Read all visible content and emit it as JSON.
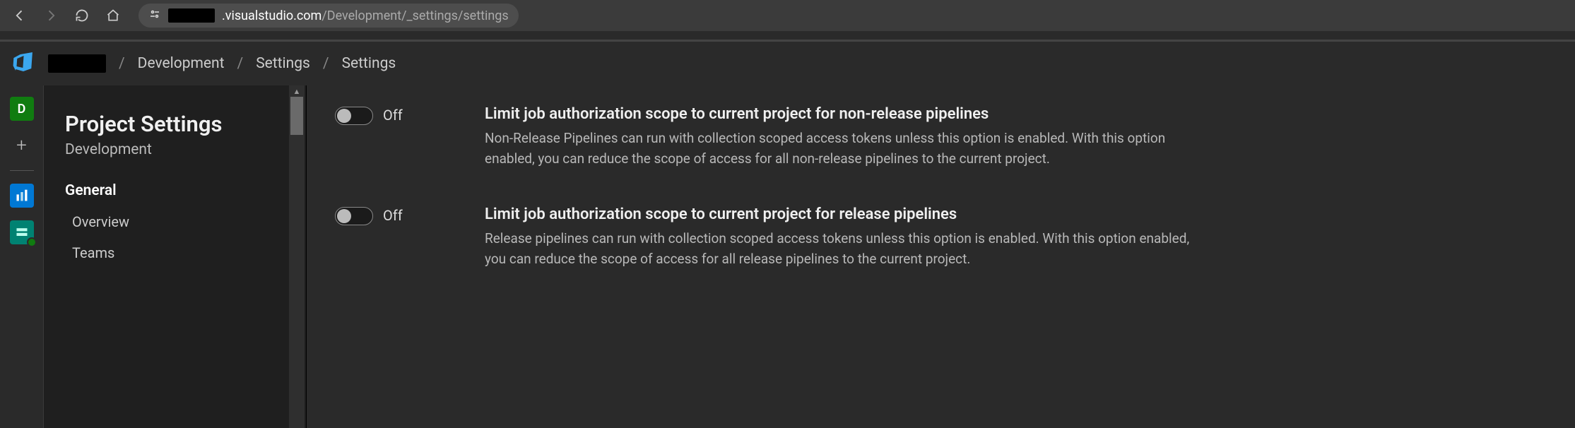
{
  "browser": {
    "url_suffix": ".visualstudio.com",
    "url_path_dim": "/Development/_settings/settings"
  },
  "breadcrumb": {
    "items": [
      "Development",
      "Settings",
      "Settings"
    ]
  },
  "leftrail": {
    "project_initial": "D"
  },
  "sidebar": {
    "title": "Project Settings",
    "project": "Development",
    "section": "General",
    "items": [
      "Overview",
      "Teams"
    ]
  },
  "settings": [
    {
      "state": "Off",
      "title": "Limit job authorization scope to current project for non-release pipelines",
      "desc": "Non-Release Pipelines can run with collection scoped access tokens unless this option is enabled. With this option enabled, you can reduce the scope of access for all non-release pipelines to the current project."
    },
    {
      "state": "Off",
      "title": "Limit job authorization scope to current project for release pipelines",
      "desc": "Release pipelines can run with collection scoped access tokens unless this option is enabled. With this option enabled, you can reduce the scope of access for all release pipelines to the current project."
    }
  ]
}
